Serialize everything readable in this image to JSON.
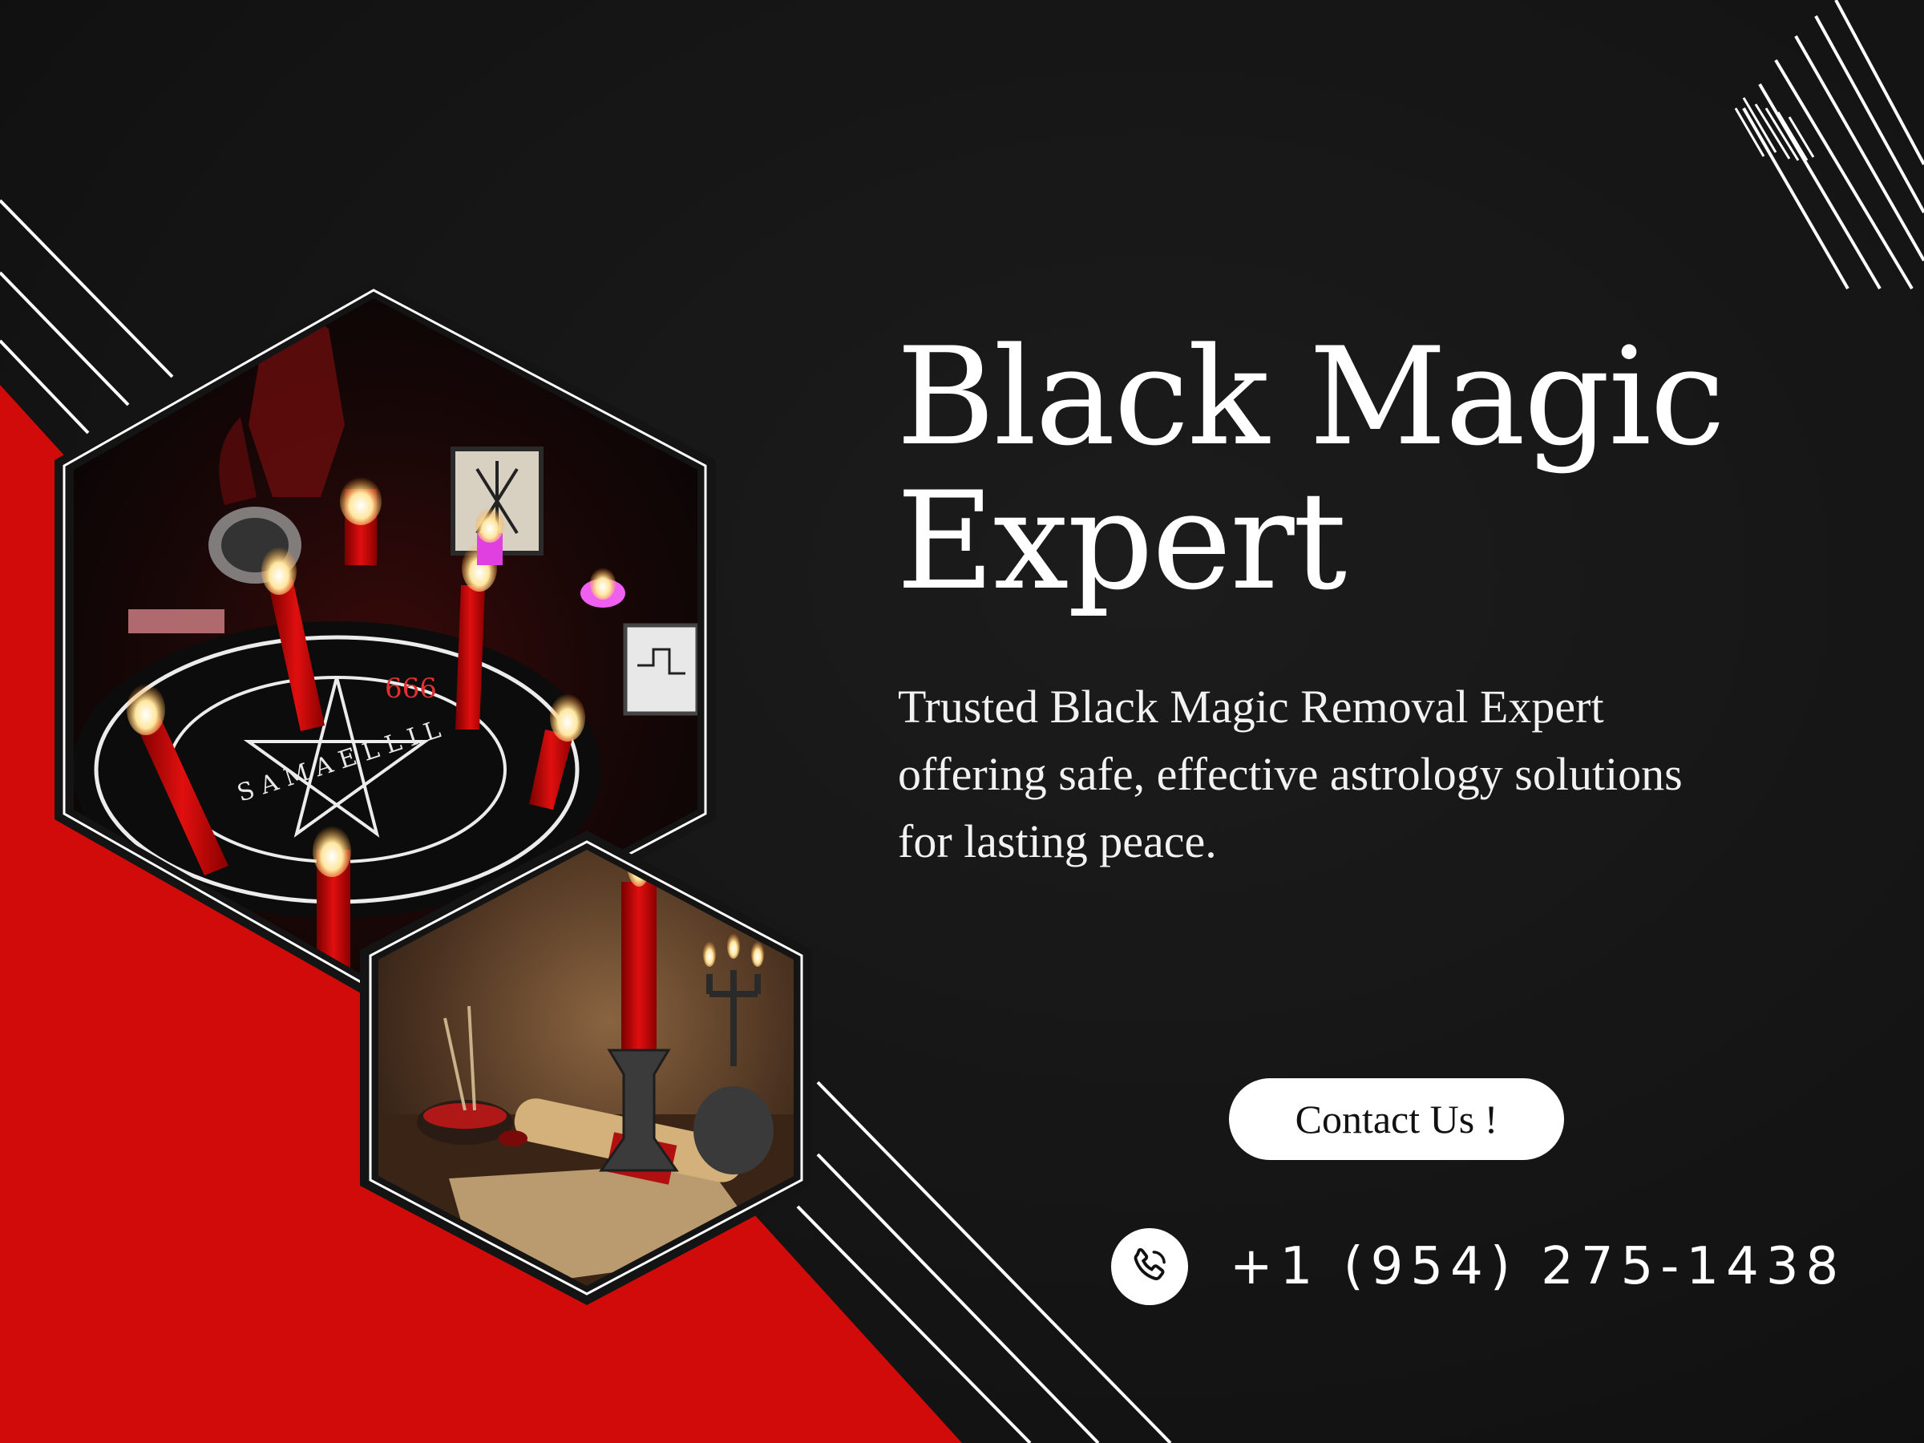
{
  "headline": {
    "line1": "Black Magic",
    "line2": "Expert"
  },
  "tagline": {
    "line1": "Trusted Black Magic Removal Expert",
    "line2": "offering safe, effective astrology solutions",
    "line3": "for lasting peace."
  },
  "contact": {
    "button_label": "Contact Us !",
    "phone_icon": "phone-icon",
    "phone_number": "+1 (954) 275-1438"
  },
  "photos": {
    "ritual_altar": {
      "visible_text": "666",
      "ring_letters": "S A M A E L  L I L"
    },
    "candle_still_life": {}
  },
  "colors": {
    "background": "#141414",
    "accent_red": "#d10a0a",
    "text": "#ffffff"
  }
}
